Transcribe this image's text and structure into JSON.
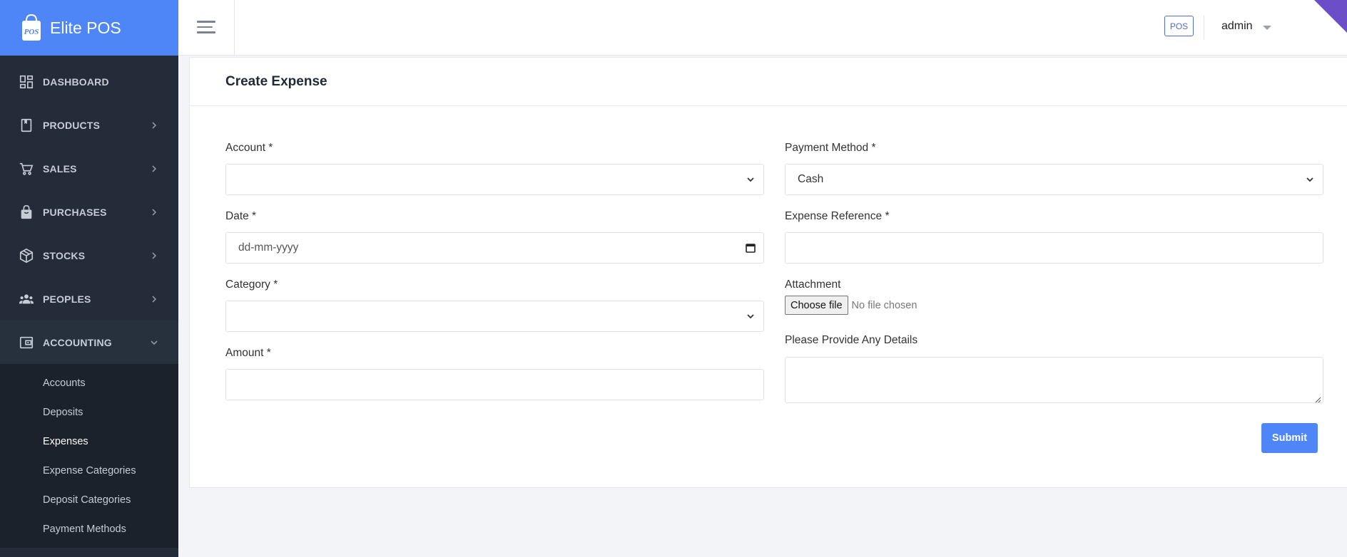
{
  "brand": {
    "name": "Elite POS",
    "logo_text": "POS"
  },
  "sidebar": {
    "items": [
      {
        "label": "DASHBOARD",
        "icon": "dashboard-icon"
      },
      {
        "label": "PRODUCTS",
        "icon": "book-icon"
      },
      {
        "label": "SALES",
        "icon": "cart-icon"
      },
      {
        "label": "PURCHASES",
        "icon": "bag-icon"
      },
      {
        "label": "STOCKS",
        "icon": "box-icon"
      },
      {
        "label": "PEOPLES",
        "icon": "people-icon"
      },
      {
        "label": "ACCOUNTING",
        "icon": "wallet-icon"
      }
    ],
    "accounting_sub": [
      {
        "label": "Accounts"
      },
      {
        "label": "Deposits"
      },
      {
        "label": "Expenses"
      },
      {
        "label": "Expense Categories"
      },
      {
        "label": "Deposit Categories"
      },
      {
        "label": "Payment Methods"
      }
    ]
  },
  "header": {
    "pos_label": "POS",
    "user_name": "admin"
  },
  "form": {
    "title": "Create Expense",
    "account_label": "Account *",
    "account_value": "",
    "date_label": "Date *",
    "date_placeholder": "dd-mm-yyyy",
    "category_label": "Category *",
    "category_value": "",
    "amount_label": "Amount *",
    "amount_value": "",
    "payment_method_label": "Payment Method *",
    "payment_method_value": "Cash",
    "reference_label": "Expense Reference *",
    "reference_value": "",
    "attachment_label": "Attachment",
    "choose_file_label": "Choose file",
    "no_file_text": "No file chosen",
    "details_label": "Please Provide Any Details",
    "details_value": "",
    "submit_label": "Submit"
  },
  "colors": {
    "accent": "#4f86f7",
    "sidebar_bg": "#232c38",
    "sidebar_sub_bg": "#1b222c",
    "corner": "#6a4fc9"
  }
}
